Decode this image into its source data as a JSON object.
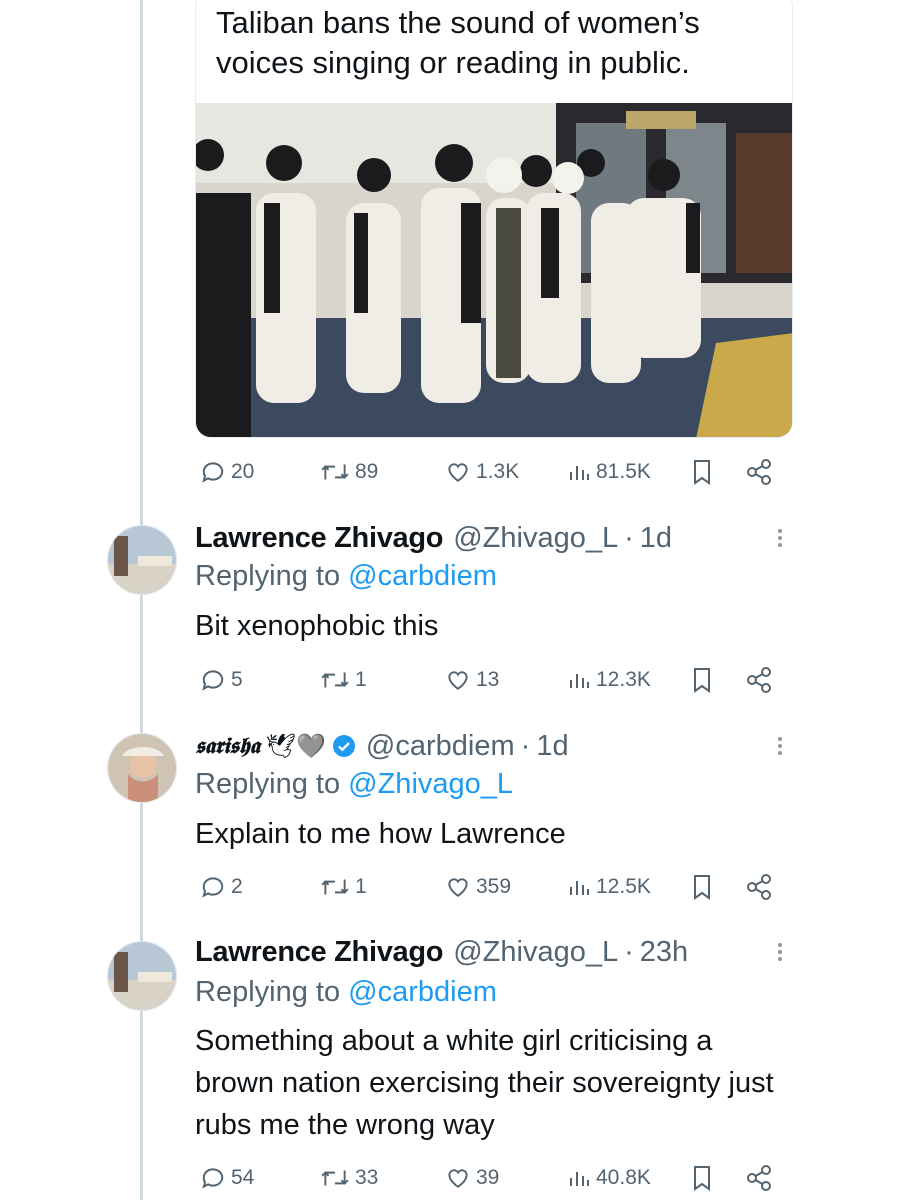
{
  "quoted_tweet": {
    "text": "Taliban bans the sound of women’s voices singing or reading in public.",
    "image_alt": "group-photo",
    "actions": {
      "replies": "20",
      "retweets": "89",
      "likes": "1.3K",
      "views": "81.5K"
    }
  },
  "replies": [
    {
      "name": "Lawrence Zhivago",
      "handle": "@Zhivago_L",
      "time": "1d",
      "replying_prefix": "Replying to ",
      "replying_to": "@carbdiem",
      "text": "Bit xenophobic this",
      "actions": {
        "replies": "5",
        "retweets": "1",
        "likes": "13",
        "views": "12.3K"
      }
    },
    {
      "name": "𝖘𝖆𝖗𝖎𝖘𝖍𝖆",
      "name_emoji": "🕊🩶",
      "verified": true,
      "handle": "@carbdiem",
      "time": "1d",
      "replying_prefix": "Replying to ",
      "replying_to": "@Zhivago_L",
      "text": "Explain to me how Lawrence",
      "actions": {
        "replies": "2",
        "retweets": "1",
        "likes": "359",
        "views": "12.5K"
      }
    },
    {
      "name": "Lawrence Zhivago",
      "handle": "@Zhivago_L",
      "time": "23h",
      "replying_prefix": "Replying to ",
      "replying_to": "@carbdiem",
      "text": "Something about a white girl criticising a brown nation exercising their sovereignty just rubs me the wrong way",
      "actions": {
        "replies": "54",
        "retweets": "33",
        "likes": "39",
        "views": "40.8K"
      }
    }
  ],
  "separator": "·",
  "colors": {
    "text": "#0f1419",
    "secondary": "#536471",
    "link": "#1d9bf0",
    "thread": "#cfd9de"
  }
}
